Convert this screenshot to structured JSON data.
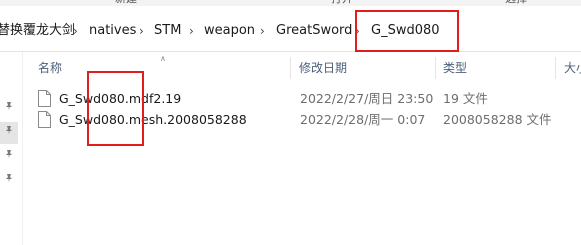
{
  "ribbon": {
    "labels": [
      "新建",
      "打开",
      "选择"
    ]
  },
  "breadcrumb": {
    "items": [
      "替换覆龙大剑",
      "natives",
      "STM",
      "weapon",
      "GreatSword",
      "G_Swd080"
    ]
  },
  "columns": {
    "name": "名称",
    "modified": "修改日期",
    "type": "类型",
    "size": "大小"
  },
  "files": [
    {
      "name": "G_Swd080.mdf2.19",
      "modified": "2022/2/27/周日 23:50",
      "type": "19 文件",
      "icon": "file-icon"
    },
    {
      "name": "G_Swd080.mesh.2008058288",
      "modified": "2022/2/28/周一 0:07",
      "type": "2008058288 文件",
      "icon": "file-icon"
    }
  ],
  "colors": {
    "annotation": "#e01e1e",
    "header_text": "#4c607a",
    "secondary_text": "#6d6d6d"
  }
}
